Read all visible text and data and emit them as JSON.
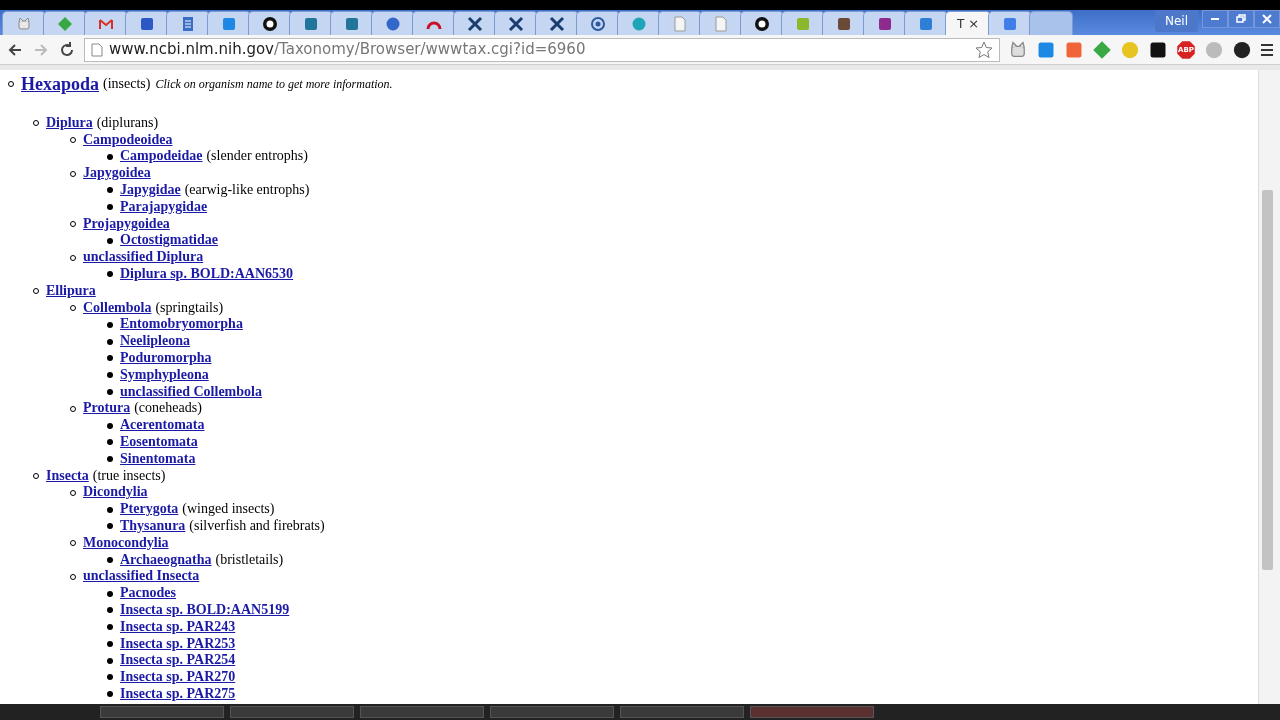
{
  "tabs": [
    {
      "kind": "cat",
      "color": "#e8e8e8",
      "selected": false
    },
    {
      "kind": "diamond",
      "color": "#3aa845",
      "selected": false
    },
    {
      "kind": "mail",
      "color": "#d93025",
      "selected": false
    },
    {
      "kind": "square",
      "color": "#2b58c4",
      "selected": false
    },
    {
      "kind": "page-lines",
      "color": "#3b6fc6",
      "selected": false
    },
    {
      "kind": "square",
      "color": "#1e88e5",
      "selected": false
    },
    {
      "kind": "octocat",
      "color": "#111111",
      "selected": false
    },
    {
      "kind": "square",
      "color": "#21759b",
      "selected": false
    },
    {
      "kind": "square",
      "color": "#21759b",
      "selected": false
    },
    {
      "kind": "circle",
      "color": "#3367c9",
      "selected": false
    },
    {
      "kind": "arc",
      "color": "#cc1122",
      "selected": false
    },
    {
      "kind": "cross",
      "color": "#1a3c6e",
      "selected": false
    },
    {
      "kind": "cross",
      "color": "#1a3c6e",
      "selected": false
    },
    {
      "kind": "cross",
      "color": "#1a3c6e",
      "selected": false
    },
    {
      "kind": "ring",
      "color": "#2c5aa0",
      "selected": false
    },
    {
      "kind": "circle",
      "color": "#1ea5b8",
      "selected": false
    },
    {
      "kind": "page",
      "color": "#f5f5f5",
      "selected": false
    },
    {
      "kind": "page",
      "color": "#f5f5f5",
      "selected": false
    },
    {
      "kind": "octocat",
      "color": "#111111",
      "selected": false
    },
    {
      "kind": "square",
      "color": "#8bb82a",
      "selected": false
    },
    {
      "kind": "square",
      "color": "#6b4a3a",
      "selected": false
    },
    {
      "kind": "square",
      "color": "#8e2a8e",
      "selected": false
    },
    {
      "kind": "square",
      "color": "#2f7fd6",
      "selected": false
    },
    {
      "selected": true,
      "title": "T",
      "close": "×"
    },
    {
      "kind": "square",
      "color": "#3f7ee8",
      "selected": false
    }
  ],
  "profile": "Neil",
  "address": {
    "host": "www.ncbi.nlm.nih.gov",
    "path": "/Taxonomy/Browser/wwwtax.cgi?id=6960"
  },
  "extensions": [
    {
      "kind": "cat",
      "color": "#dddddd"
    },
    {
      "kind": "square",
      "color": "#1e88e5"
    },
    {
      "kind": "square",
      "color": "#f0643a"
    },
    {
      "kind": "diamond",
      "color": "#3aa845"
    },
    {
      "kind": "circle",
      "color": "#e8c420"
    },
    {
      "kind": "square",
      "color": "#111111"
    },
    {
      "kind": "octagon",
      "color": "#d62222",
      "label": "ABP"
    },
    {
      "kind": "circle",
      "color": "#bbbbbb"
    },
    {
      "kind": "circle",
      "color": "#222222"
    }
  ],
  "tree": [
    {
      "name": "Hexapoda",
      "note": "(insects)",
      "hint": "Click on organism name to get more information.",
      "children": [
        {
          "name": "Diplura",
          "note": "(diplurans)",
          "children": [
            {
              "name": "Campodeoidea",
              "children": [
                {
                  "name": "Campodeidae",
                  "note": "(slender entrophs)"
                }
              ]
            },
            {
              "name": "Japygoidea",
              "children": [
                {
                  "name": "Japygidae",
                  "note": "(earwig-like entrophs)"
                },
                {
                  "name": "Parajapygidae"
                }
              ]
            },
            {
              "name": "Projapygoidea",
              "children": [
                {
                  "name": "Octostigmatidae"
                }
              ]
            },
            {
              "name": "unclassified Diplura",
              "children": [
                {
                  "name": "Diplura sp. BOLD:AAN6530"
                }
              ]
            }
          ]
        },
        {
          "name": "Ellipura",
          "children": [
            {
              "name": "Collembola",
              "note": "(springtails)",
              "children": [
                {
                  "name": "Entomobryomorpha"
                },
                {
                  "name": "Neelipleona"
                },
                {
                  "name": "Poduromorpha"
                },
                {
                  "name": "Symphypleona"
                },
                {
                  "name": "unclassified Collembola"
                }
              ]
            },
            {
              "name": "Protura",
              "note": "(coneheads)",
              "children": [
                {
                  "name": "Acerentomata"
                },
                {
                  "name": "Eosentomata"
                },
                {
                  "name": "Sinentomata"
                }
              ]
            }
          ]
        },
        {
          "name": "Insecta",
          "note": "(true insects)",
          "children": [
            {
              "name": "Dicondylia",
              "children": [
                {
                  "name": "Pterygota",
                  "note": "(winged insects)"
                },
                {
                  "name": "Thysanura",
                  "note": "(silverfish and firebrats)"
                }
              ]
            },
            {
              "name": "Monocondylia",
              "children": [
                {
                  "name": "Archaeognatha",
                  "note": "(bristletails)"
                }
              ]
            },
            {
              "name": "unclassified Insecta",
              "children": [
                {
                  "name": "Pacnodes"
                },
                {
                  "name": "Insecta sp. BOLD:AAN5199"
                },
                {
                  "name": "Insecta sp. PAR243"
                },
                {
                  "name": "Insecta sp. PAR253"
                },
                {
                  "name": "Insecta sp. PAR254"
                },
                {
                  "name": "Insecta sp. PAR270"
                },
                {
                  "name": "Insecta sp. PAR275"
                }
              ]
            }
          ]
        }
      ]
    }
  ],
  "taskbar": [
    {
      "selected": false
    },
    {
      "selected": false
    },
    {
      "selected": false
    },
    {
      "selected": false
    },
    {
      "selected": false
    },
    {
      "selected": true
    }
  ]
}
